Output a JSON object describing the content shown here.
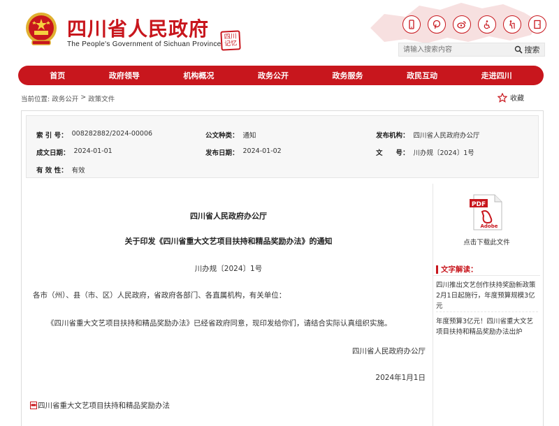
{
  "header": {
    "title": "四川省人民政府",
    "subtitle": "The People's Government of Sichuan Province",
    "seal_text": "四川\n记忆"
  },
  "tools": [
    {
      "icon": "mobile-icon"
    },
    {
      "icon": "pinterest-icon"
    },
    {
      "icon": "weibo-icon"
    },
    {
      "icon": "accessibility-icon"
    },
    {
      "icon": "elderly-mode-icon"
    },
    {
      "icon": "exit-icon"
    }
  ],
  "search": {
    "placeholder": "请输入搜索内容",
    "button_label": "搜索"
  },
  "nav": {
    "items": [
      "首页",
      "政府领导",
      "机构概况",
      "政务公开",
      "政务服务",
      "政民互动",
      "走进四川"
    ]
  },
  "breadcrumb": {
    "label": "当前位置:",
    "items": [
      "政务公开",
      "政策文件"
    ],
    "sep": ">"
  },
  "favorite": {
    "label": "收藏"
  },
  "meta": {
    "index_label": "索 引 号：",
    "index_value": "008282882/2024-00006",
    "type_label": "公文种类：",
    "type_value": "通知",
    "issuer_label": "发布机构：",
    "issuer_value": "四川省人民政府办公厅",
    "written_label": "成文日期：",
    "written_value": "2024-01-01",
    "published_label": "发布日期：",
    "published_value": "2024-01-02",
    "docno_label": "文　　号：",
    "docno_value": "川办规〔2024〕1号",
    "validity_label": "有 效 性：",
    "validity_value": "有效"
  },
  "doc": {
    "issuer": "四川省人民政府办公厅",
    "title": "关于印发《四川省重大文艺项目扶持和精品奖励办法》的通知",
    "number": "川办规〔2024〕1号",
    "recipients": "各市（州）、县（市、区）人民政府，省政府各部门、各直属机构，有关单位：",
    "body": "《四川省重大文艺项目扶持和精品奖励办法》已经省政府同意，现印发给你们，请结合实际认真组织实施。",
    "signature": "四川省人民政府办公厅",
    "date": "2024年1月1日",
    "attachment": "四川省重大文艺项目扶持和精品奖励办法"
  },
  "sidebar": {
    "download_label": "点击下载此文件",
    "interp_title": "文字解读：",
    "interp_items": [
      "四川推出文艺创作扶持奖励新政策2月1日起施行，年度预算规模3亿元",
      "年度预算3亿元！四川省重大文艺项目扶持和精品奖励办法出炉"
    ]
  },
  "colors": {
    "brand_red": "#c8161d"
  }
}
